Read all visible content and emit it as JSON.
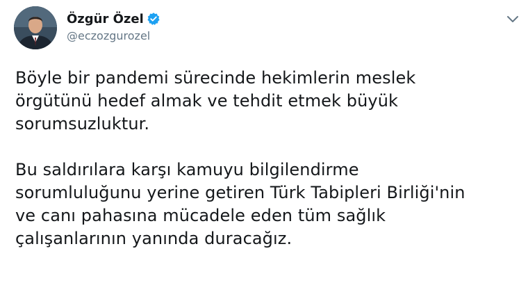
{
  "author": {
    "display_name": "Özgür Özel",
    "handle": "@eczozgurozel",
    "verified": true
  },
  "icons": {
    "avatar": "profile-photo",
    "verified": "verified-badge-icon",
    "menu": "chevron-down-icon"
  },
  "colors": {
    "text": "#14171a",
    "handle": "#657786",
    "verified": "#1da1f2",
    "caret": "#657786"
  },
  "tweet": {
    "paragraph_1": [
      "Böyle bir pandemi sürecinde hekimlerin meslek",
      "örgütünü hedef almak ve tehdit etmek büyük",
      "sorumsuzluktur."
    ],
    "paragraph_2": [
      "Bu saldırılara karşı kamuyu bilgilendirme",
      "sorumluluğunu yerine getiren Türk Tabipleri Birliği'nin",
      "ve canı pahasına mücadele eden tüm sağlık",
      "çalışanlarının yanında duracağız."
    ]
  }
}
